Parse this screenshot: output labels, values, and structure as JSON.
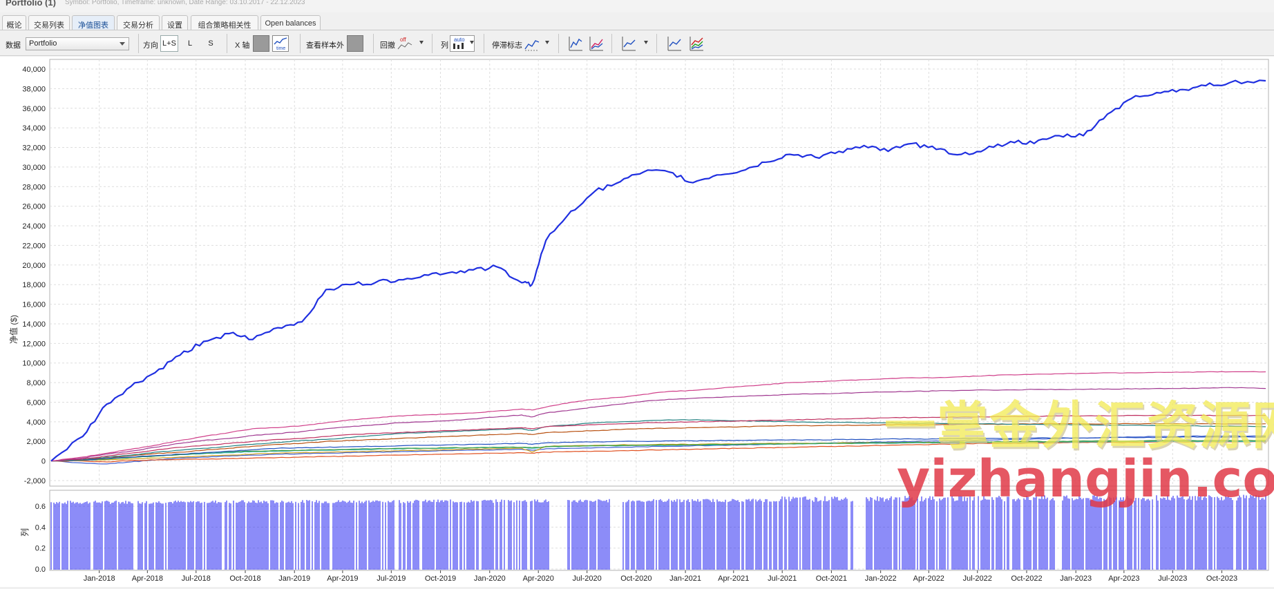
{
  "window": {
    "title": "Portfolio (1)",
    "subtitle": "Symbol: Portfolio, Timeframe: unknown, Date Range: 03.10.2017 - 22.12.2023"
  },
  "tabs": [
    {
      "label": "概论",
      "active": false
    },
    {
      "label": "交易列表",
      "active": false
    },
    {
      "label": "净值图表",
      "active": true
    },
    {
      "label": "交易分析",
      "active": false
    },
    {
      "label": "设置",
      "active": false
    },
    {
      "label": "组合策略相关性",
      "active": false
    },
    {
      "label": "Open balances",
      "active": false
    }
  ],
  "toolbar": {
    "data_label": "数据",
    "data_value": "Portfolio",
    "direction_label": "方向",
    "dir_ls": "L+S",
    "dir_l": "L",
    "dir_s": "S",
    "xaxis_label": "X 轴",
    "sample_label": "查看样本外",
    "drawdown_label": "回撤",
    "drawdown_icon_text": "off",
    "series_label": "列",
    "series_icon_text": "auto",
    "stagnation_label": "停滞标志",
    "time_icon_text": "time",
    "active_dir": "L+S"
  },
  "colors": {
    "portfolio": "#1f2fe0",
    "histogram": "#1a1af0",
    "grid": "#dddddd"
  },
  "watermark": {
    "line1": "一掌金外汇资源网",
    "line2": "yizhangjin.com"
  },
  "chart_data": [
    {
      "type": "line",
      "ylabel": "净值 ($)",
      "ylim": [
        -2000,
        40000
      ],
      "yticks": [
        "40,000",
        "38,000",
        "36,000",
        "34,000",
        "32,000",
        "30,000",
        "28,000",
        "26,000",
        "24,000",
        "22,000",
        "20,000",
        "18,000",
        "16,000",
        "14,000",
        "12,000",
        "10,000",
        "8,000",
        "6,000",
        "4,000",
        "2,000",
        "0",
        "-2,000"
      ],
      "x_labels": [
        "Jan-2018",
        "Apr-2018",
        "Jul-2018",
        "Oct-2018",
        "Jan-2019",
        "Apr-2019",
        "Jul-2019",
        "Oct-2019",
        "Jan-2020",
        "Apr-2020",
        "Jul-2020",
        "Oct-2020",
        "Jan-2021",
        "Apr-2021",
        "Jul-2021",
        "Oct-2021",
        "Jan-2022",
        "Apr-2022",
        "Jul-2022",
        "Oct-2022",
        "Jan-2023",
        "Apr-2023",
        "Jul-2023",
        "Oct-2023"
      ],
      "grid": true,
      "x": [
        "2017-10-03",
        "2017-12-01",
        "2018-01-15",
        "2018-03-01",
        "2018-04-15",
        "2018-06-01",
        "2018-07-15",
        "2018-09-01",
        "2018-10-15",
        "2018-12-01",
        "2019-01-15",
        "2019-03-01",
        "2019-04-15",
        "2019-06-01",
        "2019-07-15",
        "2019-09-01",
        "2019-10-15",
        "2019-12-01",
        "2020-01-15",
        "2020-03-01",
        "2020-03-20",
        "2020-04-15",
        "2020-06-01",
        "2020-07-15",
        "2020-09-01",
        "2020-10-15",
        "2020-12-01",
        "2021-01-15",
        "2021-03-01",
        "2021-04-15",
        "2021-06-01",
        "2021-07-15",
        "2021-09-01",
        "2021-10-15",
        "2021-12-01",
        "2022-01-15",
        "2022-03-01",
        "2022-04-15",
        "2022-06-01",
        "2022-07-15",
        "2022-09-01",
        "2022-10-15",
        "2022-12-01",
        "2023-01-15",
        "2023-03-01",
        "2023-04-15",
        "2023-06-01",
        "2023-07-15",
        "2023-09-01",
        "2023-10-15",
        "2023-12-22"
      ],
      "series": [
        {
          "color": "#1f2fe0",
          "width": 2.2,
          "values": [
            0,
            2500,
            5800,
            7600,
            9000,
            10800,
            12200,
            13000,
            12400,
            13600,
            14200,
            17500,
            18000,
            18200,
            18500,
            19000,
            19200,
            19500,
            19800,
            18200,
            18000,
            22500,
            25500,
            27500,
            28500,
            29500,
            29500,
            28400,
            29200,
            29600,
            30500,
            31300,
            31000,
            31600,
            32200,
            31600,
            32400,
            31800,
            31300,
            31800,
            32600,
            32400,
            33200,
            33200,
            35400,
            37000,
            37600,
            37900,
            38300,
            38600,
            38800
          ]
        },
        {
          "color": "#d0408a",
          "width": 1.2,
          "values": [
            0,
            400,
            800,
            1200,
            1600,
            2100,
            2500,
            2900,
            3300,
            3400,
            3600,
            3900,
            4200,
            4400,
            4600,
            4700,
            4800,
            4900,
            5100,
            5300,
            5200,
            5500,
            6000,
            6300,
            6500,
            6800,
            7100,
            7200,
            7400,
            7600,
            7800,
            8000,
            8100,
            8200,
            8300,
            8400,
            8500,
            8500,
            8600,
            8700,
            8800,
            8850,
            8900,
            8950,
            9000,
            9000,
            9050,
            9050,
            9100,
            9100,
            9100
          ]
        },
        {
          "color": "#a03890",
          "width": 1.2,
          "values": [
            0,
            300,
            700,
            1000,
            1400,
            1800,
            2100,
            2300,
            2600,
            2800,
            3000,
            3300,
            3500,
            3700,
            3900,
            4000,
            4100,
            4300,
            4500,
            4700,
            4500,
            4900,
            5200,
            5500,
            5800,
            6100,
            6300,
            6400,
            6500,
            6600,
            6700,
            6800,
            6850,
            6900,
            7000,
            7050,
            7100,
            7150,
            7200,
            7250,
            7250,
            7300,
            7300,
            7300,
            7350,
            7350,
            7400,
            7400,
            7450,
            7500,
            7400
          ]
        },
        {
          "color": "#c03060",
          "width": 1.2,
          "values": [
            0,
            200,
            500,
            800,
            1100,
            1400,
            1600,
            1800,
            2000,
            2200,
            2300,
            2500,
            2700,
            2800,
            2900,
            3000,
            3100,
            3200,
            3300,
            3400,
            3300,
            3500,
            3600,
            3700,
            3800,
            3900,
            3950,
            4000,
            4050,
            4100,
            4150,
            4200,
            4250,
            4300,
            4350,
            4400,
            4450,
            4450,
            4500,
            4500,
            4550,
            4550,
            4600,
            4600,
            4600,
            4650,
            4650,
            4650,
            4650,
            4650,
            4650
          ]
        },
        {
          "color": "#208080",
          "width": 1.2,
          "values": [
            0,
            150,
            400,
            600,
            900,
            1100,
            1300,
            1500,
            1700,
            1900,
            2100,
            2200,
            2400,
            2600,
            2800,
            2900,
            3000,
            3100,
            3200,
            3300,
            3100,
            3500,
            3700,
            3900,
            4000,
            4100,
            4200,
            4200,
            4150,
            4100,
            4050,
            4000,
            3950,
            3950,
            3900,
            3900,
            3850,
            3850,
            3800,
            3800,
            3750,
            3750,
            3700,
            3700,
            3650,
            3650,
            3600,
            3600,
            3550,
            3550,
            3500
          ]
        },
        {
          "color": "#b85010",
          "width": 1.2,
          "values": [
            0,
            150,
            350,
            550,
            750,
            900,
            1100,
            1300,
            1500,
            1700,
            1800,
            2000,
            2100,
            2200,
            2300,
            2400,
            2500,
            2600,
            2700,
            2800,
            2700,
            2900,
            3000,
            3100,
            3200,
            3300,
            3350,
            3400,
            3450,
            3500,
            3550,
            3600,
            3600,
            3650,
            3650,
            3700,
            3700,
            3700,
            3750,
            3750,
            3750,
            3800,
            3800,
            3800,
            3800,
            3800,
            3800,
            3800,
            3800,
            3800,
            3800
          ]
        },
        {
          "color": "#2050c0",
          "width": 1.2,
          "values": [
            0,
            100,
            250,
            400,
            550,
            700,
            850,
            1000,
            1150,
            1300,
            1350,
            1400,
            1450,
            1500,
            1550,
            1600,
            1650,
            1700,
            1750,
            1800,
            1700,
            1850,
            1900,
            1950,
            2000,
            2000,
            2050,
            2050,
            2100,
            2100,
            2150,
            2150,
            2150,
            2200,
            2200,
            2250,
            2250,
            2250,
            2300,
            2300,
            2300,
            2350,
            2350,
            2350,
            2400,
            2400,
            2400,
            2450,
            2450,
            2450,
            2450
          ]
        },
        {
          "color": "#40a040",
          "width": 1.2,
          "values": [
            0,
            100,
            200,
            350,
            500,
            650,
            800,
            950,
            1000,
            1050,
            1100,
            1150,
            1200,
            1250,
            1300,
            1300,
            1350,
            1350,
            1400,
            1400,
            1350,
            1450,
            1500,
            1550,
            1600,
            1600,
            1650,
            1650,
            1700,
            1700,
            1750,
            1750,
            1800,
            1800,
            1850,
            1850,
            1900,
            1900,
            1950,
            1950,
            2000,
            2000,
            2000,
            2050,
            2050,
            2050,
            2100,
            2100,
            2100,
            2100,
            2100
          ]
        },
        {
          "color": "#30b0b0",
          "width": 1.2,
          "values": [
            0,
            80,
            200,
            350,
            500,
            650,
            750,
            850,
            950,
            1000,
            1050,
            1100,
            1150,
            1200,
            1250,
            1300,
            1300,
            1350,
            1350,
            1400,
            1300,
            1450,
            1500,
            1550,
            1550,
            1600,
            1600,
            1650,
            1650,
            1700,
            1700,
            1750,
            1750,
            1800,
            1800,
            1800,
            1850,
            1850,
            1850,
            1900,
            1900,
            1900,
            1950,
            1950,
            1950,
            2000,
            2000,
            2000,
            2000,
            2000,
            2000
          ]
        },
        {
          "color": "#d0a020",
          "width": 1.2,
          "values": [
            0,
            50,
            120,
            200,
            300,
            400,
            500,
            600,
            700,
            800,
            850,
            900,
            950,
            1000,
            1050,
            1100,
            1150,
            1200,
            1250,
            1300,
            900,
            1500,
            1550,
            1600,
            1650,
            1650,
            1700,
            1700,
            1750,
            1750,
            1800,
            1800,
            1800,
            1850,
            1850,
            1850,
            1900,
            1900,
            1900,
            1900,
            1950,
            1950,
            1950,
            1950,
            2000,
            2000,
            2000,
            2000,
            2000,
            2000,
            2000
          ]
        },
        {
          "color": "#e05020",
          "width": 1.2,
          "values": [
            0,
            0,
            -100,
            50,
            100,
            150,
            200,
            250,
            300,
            350,
            400,
            450,
            500,
            550,
            600,
            650,
            700,
            750,
            800,
            850,
            800,
            900,
            950,
            1000,
            1050,
            1100,
            1150,
            1200,
            1250,
            1300,
            1350,
            1400,
            1450,
            1500,
            1550,
            1600,
            1650,
            1700,
            1750,
            1800,
            1800,
            1850,
            1850,
            1900,
            1900,
            1900,
            1950,
            1950,
            1950,
            1950,
            1950
          ]
        },
        {
          "color": "#4060d0",
          "width": 1.2,
          "values": [
            0,
            -200,
            -300,
            -100,
            100,
            300,
            400,
            500,
            600,
            700,
            750,
            800,
            850,
            900,
            950,
            1000,
            1050,
            1100,
            1150,
            1200,
            1100,
            1250,
            1300,
            1350,
            1400,
            1450,
            1500,
            1550,
            1600,
            1650,
            1700,
            1750,
            1800,
            1850,
            1900,
            1950,
            2000,
            2050,
            2100,
            2150,
            2200,
            2250,
            2300,
            2350,
            2400,
            2450,
            2500,
            2500,
            2550,
            2550,
            2550
          ]
        }
      ]
    },
    {
      "type": "bar",
      "ylabel": "列",
      "ylim": [
        0,
        0.7
      ],
      "yticks": [
        "0.6",
        "0.4",
        "0.2",
        "0.0"
      ],
      "x_labels": [
        "Jan-2018",
        "Apr-2018",
        "Jul-2018",
        "Oct-2018",
        "Jan-2019",
        "Apr-2019",
        "Jul-2019",
        "Oct-2019",
        "Jan-2020",
        "Apr-2020",
        "Jul-2020",
        "Oct-2020",
        "Jan-2021",
        "Apr-2021",
        "Jul-2021",
        "Oct-2021",
        "Jan-2022",
        "Apr-2022",
        "Jul-2022",
        "Oct-2022",
        "Jan-2023",
        "Apr-2023",
        "Jul-2023",
        "Oct-2023"
      ],
      "value_range": [
        0.62,
        0.72
      ]
    }
  ]
}
